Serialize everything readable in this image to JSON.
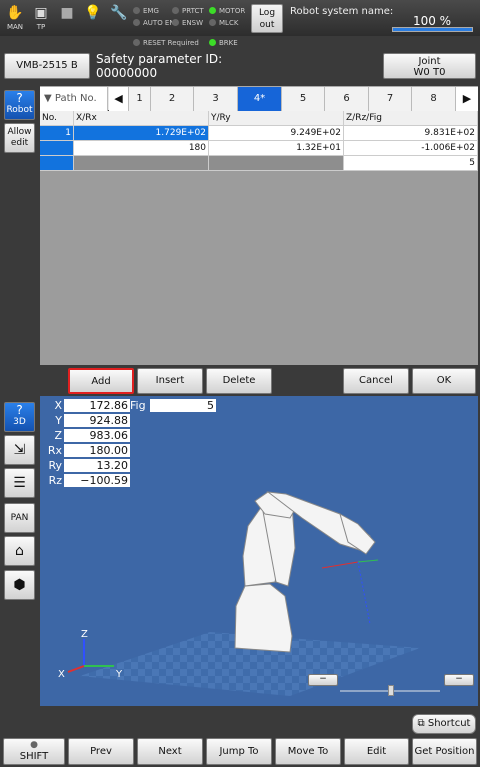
{
  "topbar": {
    "man_label": "MAN",
    "tp_label": "TP",
    "leds_col1": [
      "EMG",
      "AUTO EN"
    ],
    "leds_col2": [
      "PRTCT",
      "ENSW"
    ],
    "leds_col3": [
      "MOTOR",
      "MLCK"
    ],
    "logout_label_1": "Log",
    "logout_label_2": "out",
    "system_name_label": "Robot system name:",
    "speed_percent": "100 %",
    "speed_fill_percent": 100
  },
  "status_row": {
    "reset_required": "RESET Required",
    "brke": "BRKE"
  },
  "header": {
    "robot_model": "VMB-2515 B",
    "safety_label": "Safety parameter ID:",
    "safety_id": "00000000",
    "joint_label": "Joint",
    "joint_sub": "W0 T0"
  },
  "left_panel": {
    "robot_label": "Robot",
    "allow_edit_line1": "Allow",
    "allow_edit_line2": "edit",
    "view_3d_label": "3D",
    "pan_label": "PAN"
  },
  "path_tabs": {
    "header": "Path No.",
    "tabs": [
      "1",
      "2",
      "3",
      "4*",
      "5",
      "6",
      "7",
      "8"
    ],
    "selected_index": 3
  },
  "table": {
    "columns": [
      "No.",
      "X/Rx",
      "Y/Ry",
      "Z/Rz/Fig"
    ],
    "rows": [
      {
        "no": "1",
        "x": "1.729E+02",
        "y": "9.249E+02",
        "z": "9.831E+02"
      },
      {
        "no": "",
        "x": "180",
        "y": "1.32E+01",
        "z": "-1.006E+02"
      },
      {
        "no": "",
        "x": "",
        "y": "",
        "z": "5"
      }
    ]
  },
  "actions": {
    "add": "Add",
    "insert": "Insert",
    "delete": "Delete",
    "cancel": "Cancel",
    "ok": "OK"
  },
  "coords": {
    "x_label": "X",
    "x": "172.86",
    "y_label": "Y",
    "y": "924.88",
    "z_label": "Z",
    "z": "983.06",
    "rx_label": "Rx",
    "rx": "180.00",
    "ry_label": "Ry",
    "ry": "13.20",
    "rz_label": "Rz",
    "rz": "−100.59",
    "fig_label": "Fig",
    "fig": "5"
  },
  "axis_labels": {
    "x": "X",
    "y": "Y",
    "z": "Z"
  },
  "colors": {
    "accent_blue": "#1665d8",
    "viewport_bg": "#3d67a6",
    "led_on": "#3cdc28",
    "add_border": "#e02020"
  },
  "bottom": {
    "shortcut": "Shortcut",
    "shift": "SHIFT",
    "prev": "Prev",
    "next": "Next",
    "jump_to": "Jump To",
    "move_to": "Move To",
    "edit": "Edit",
    "get_position": "Get Position"
  }
}
